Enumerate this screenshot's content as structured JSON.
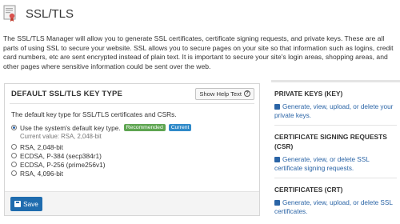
{
  "page": {
    "title": "SSL/TLS",
    "description": "The SSL/TLS Manager will allow you to generate SSL certificates, certificate signing requests, and private keys. These are all parts of using SSL to secure your website. SSL allows you to secure pages on your site so that information such as logins, credit card numbers, etc are sent encrypted instead of plain text. It is important to secure your site's login areas, shopping areas, and other pages where sensitive information could be sent over the web."
  },
  "key_type_panel": {
    "title": "DEFAULT SSL/TLS KEY TYPE",
    "help_label": "Show Help Text",
    "intro": "The default key type for SSL/TLS certificates and CSRs.",
    "options": [
      {
        "label": "Use the system's default key type.",
        "selected": true
      },
      {
        "label": "RSA, 2,048-bit",
        "selected": false
      },
      {
        "label": "ECDSA, P-384 (secp384r1)",
        "selected": false
      },
      {
        "label": "ECDSA, P-256 (prime256v1)",
        "selected": false
      },
      {
        "label": "RSA, 4,096-bit",
        "selected": false
      }
    ],
    "badge_recommended": "Recommended",
    "badge_current": "Current",
    "current_value": "Current value: RSA, 2,048-bit",
    "save_label": "Save"
  },
  "sidebar": {
    "sections": [
      {
        "title": "PRIVATE KEYS (KEY)",
        "link": "Generate, view, upload, or delete your private keys."
      },
      {
        "title": "CERTIFICATE SIGNING REQUESTS (CSR)",
        "link": "Generate, view, or delete SSL certificate signing requests."
      },
      {
        "title": "CERTIFICATES (CRT)",
        "link": "Generate, view, upload, or delete SSL certificates."
      }
    ]
  },
  "colors": {
    "link": "#2a64a6",
    "save_button": "#1f6cae",
    "recommended": "#5ea551",
    "current": "#2f8ac9"
  }
}
